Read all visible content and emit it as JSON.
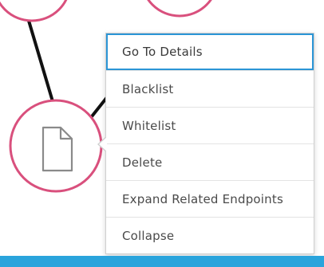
{
  "colors": {
    "node_border": "#d9507d",
    "edge": "#111111",
    "menu_active_border": "#2b95d6",
    "bottom_bar": "#2aa4dc",
    "menu_text": "#4a4a4a",
    "file_icon_stroke": "#8a8a8a"
  },
  "graph": {
    "selected_node_icon": "file-icon"
  },
  "context_menu": {
    "items": [
      {
        "label": "Go To Details",
        "active": true
      },
      {
        "label": "Blacklist",
        "active": false
      },
      {
        "label": "Whitelist",
        "active": false
      },
      {
        "label": "Delete",
        "active": false
      },
      {
        "label": "Expand Related Endpoints",
        "active": false
      },
      {
        "label": "Collapse",
        "active": false
      }
    ]
  }
}
